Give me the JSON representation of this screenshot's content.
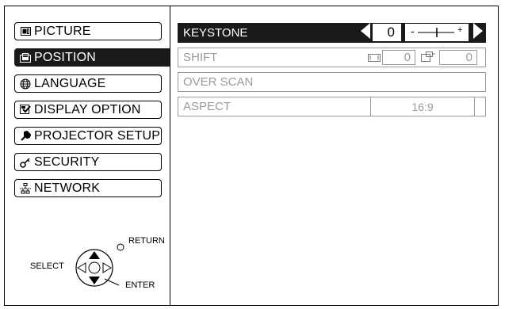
{
  "menu": {
    "items": [
      {
        "label": "PICTURE",
        "icon": "picture-icon"
      },
      {
        "label": "POSITION",
        "icon": "position-icon",
        "selected": true
      },
      {
        "label": "LANGUAGE",
        "icon": "globe-icon"
      },
      {
        "label": "DISPLAY OPTION",
        "icon": "display-option-icon"
      },
      {
        "label": "PROJECTOR SETUP",
        "icon": "wrench-icon"
      },
      {
        "label": "SECURITY",
        "icon": "key-icon"
      },
      {
        "label": "NETWORK",
        "icon": "network-icon"
      }
    ]
  },
  "panel": {
    "keystone": {
      "label": "KEYSTONE",
      "value": "0",
      "slider_minus": "-",
      "slider_plus": "+"
    },
    "shift": {
      "label": "SHIFT",
      "h_value": "0",
      "v_value": "0"
    },
    "overscan": {
      "label": "OVER SCAN"
    },
    "aspect": {
      "label": "ASPECT",
      "value": "16:9"
    }
  },
  "nav_hint": {
    "select": "SELECT",
    "return": "RETURN",
    "enter": "ENTER"
  },
  "colors": {
    "selected_bg": "#1a1a1a",
    "disabled_text": "#9a9a9a",
    "border": "#000000"
  }
}
